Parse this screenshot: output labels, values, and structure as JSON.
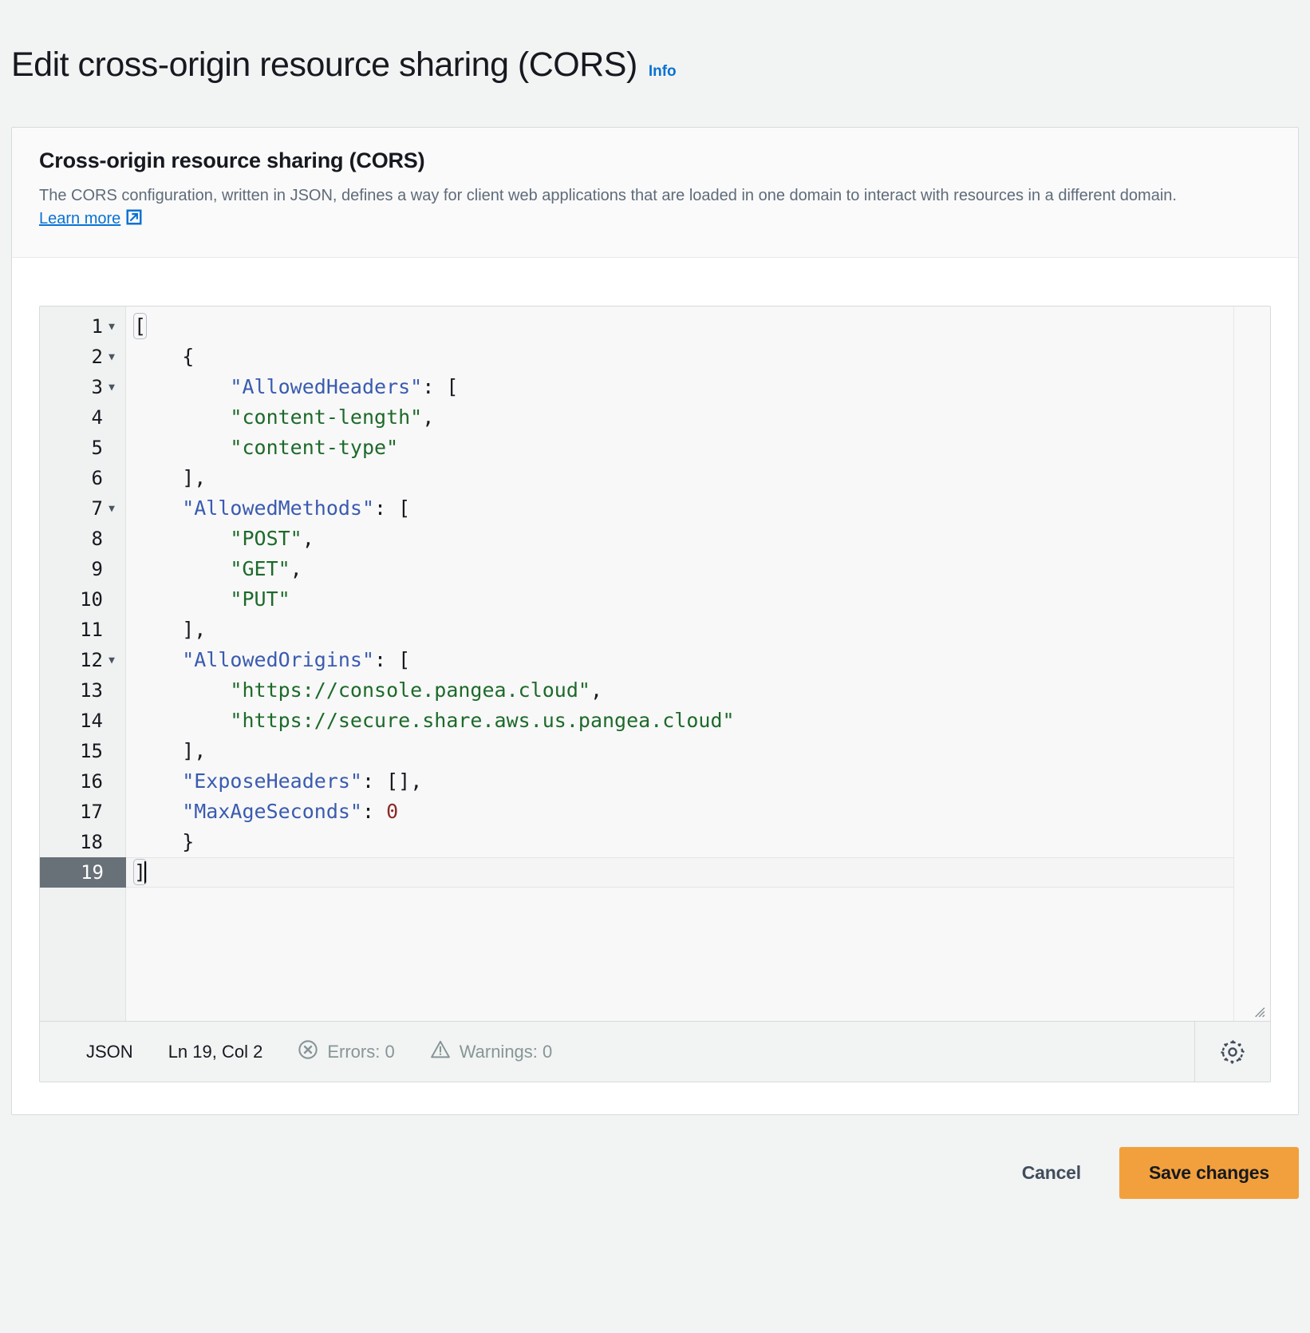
{
  "page": {
    "title": "Edit cross-origin resource sharing (CORS)",
    "info_label": "Info"
  },
  "container": {
    "title": "Cross-origin resource sharing (CORS)",
    "description_part1": "The CORS configuration, written in JSON, defines a way for client web applications that are loaded in one domain to interact with resources in a different domain. ",
    "learn_more_label": "Learn more",
    "external_link_icon": "external-link-icon"
  },
  "editor": {
    "language": "JSON",
    "lines": [
      {
        "n": "1",
        "fold": true,
        "active": false,
        "tokens": [
          {
            "t": "punct",
            "v": "[",
            "match": true
          }
        ]
      },
      {
        "n": "2",
        "fold": true,
        "active": false,
        "tokens": [
          {
            "t": "punct",
            "v": "    {"
          }
        ]
      },
      {
        "n": "3",
        "fold": true,
        "active": false,
        "tokens": [
          {
            "t": "key",
            "v": "        \"AllowedHeaders\""
          },
          {
            "t": "punct",
            "v": ": ["
          }
        ]
      },
      {
        "n": "4",
        "fold": false,
        "active": false,
        "tokens": [
          {
            "t": "str",
            "v": "        \"content-length\""
          },
          {
            "t": "punct",
            "v": ","
          }
        ]
      },
      {
        "n": "5",
        "fold": false,
        "active": false,
        "tokens": [
          {
            "t": "str",
            "v": "        \"content-type\""
          }
        ]
      },
      {
        "n": "6",
        "fold": false,
        "active": false,
        "tokens": [
          {
            "t": "punct",
            "v": "    ],"
          }
        ]
      },
      {
        "n": "7",
        "fold": true,
        "active": false,
        "tokens": [
          {
            "t": "key",
            "v": "    \"AllowedMethods\""
          },
          {
            "t": "punct",
            "v": ": ["
          }
        ]
      },
      {
        "n": "8",
        "fold": false,
        "active": false,
        "tokens": [
          {
            "t": "str",
            "v": "        \"POST\""
          },
          {
            "t": "punct",
            "v": ","
          }
        ]
      },
      {
        "n": "9",
        "fold": false,
        "active": false,
        "tokens": [
          {
            "t": "str",
            "v": "        \"GET\""
          },
          {
            "t": "punct",
            "v": ","
          }
        ]
      },
      {
        "n": "10",
        "fold": false,
        "active": false,
        "tokens": [
          {
            "t": "str",
            "v": "        \"PUT\""
          }
        ]
      },
      {
        "n": "11",
        "fold": false,
        "active": false,
        "tokens": [
          {
            "t": "punct",
            "v": "    ],"
          }
        ]
      },
      {
        "n": "12",
        "fold": true,
        "active": false,
        "tokens": [
          {
            "t": "key",
            "v": "    \"AllowedOrigins\""
          },
          {
            "t": "punct",
            "v": ": ["
          }
        ]
      },
      {
        "n": "13",
        "fold": false,
        "active": false,
        "tokens": [
          {
            "t": "str",
            "v": "        \"https://console.pangea.cloud\""
          },
          {
            "t": "punct",
            "v": ","
          }
        ]
      },
      {
        "n": "14",
        "fold": false,
        "active": false,
        "tokens": [
          {
            "t": "str",
            "v": "        \"https://secure.share.aws.us.pangea.cloud\""
          }
        ]
      },
      {
        "n": "15",
        "fold": false,
        "active": false,
        "tokens": [
          {
            "t": "punct",
            "v": "    ],"
          }
        ]
      },
      {
        "n": "16",
        "fold": false,
        "active": false,
        "tokens": [
          {
            "t": "key",
            "v": "    \"ExposeHeaders\""
          },
          {
            "t": "punct",
            "v": ": [],"
          }
        ]
      },
      {
        "n": "17",
        "fold": false,
        "active": false,
        "tokens": [
          {
            "t": "key",
            "v": "    \"MaxAgeSeconds\""
          },
          {
            "t": "punct",
            "v": ": "
          },
          {
            "t": "num",
            "v": "0"
          }
        ]
      },
      {
        "n": "18",
        "fold": false,
        "active": false,
        "tokens": [
          {
            "t": "punct",
            "v": "    }"
          }
        ]
      },
      {
        "n": "19",
        "fold": false,
        "active": true,
        "tokens": [
          {
            "t": "punct",
            "v": "]",
            "match": true
          },
          {
            "t": "caret",
            "v": ""
          }
        ]
      }
    ]
  },
  "status": {
    "language_label": "JSON",
    "cursor_label": "Ln 19, Col 2",
    "errors_label": "Errors: 0",
    "warnings_label": "Warnings: 0",
    "errors_icon": "error-circle-icon",
    "warnings_icon": "warning-triangle-icon",
    "settings_icon": "gear-icon"
  },
  "footer": {
    "cancel_label": "Cancel",
    "save_label": "Save changes"
  },
  "colors": {
    "link": "#0972d3",
    "primary_button": "#f2a03d",
    "json_key": "#3a5bb0",
    "json_string": "#1d6a2a",
    "json_number": "#8b2a2a",
    "active_line_gutter": "#687078"
  }
}
